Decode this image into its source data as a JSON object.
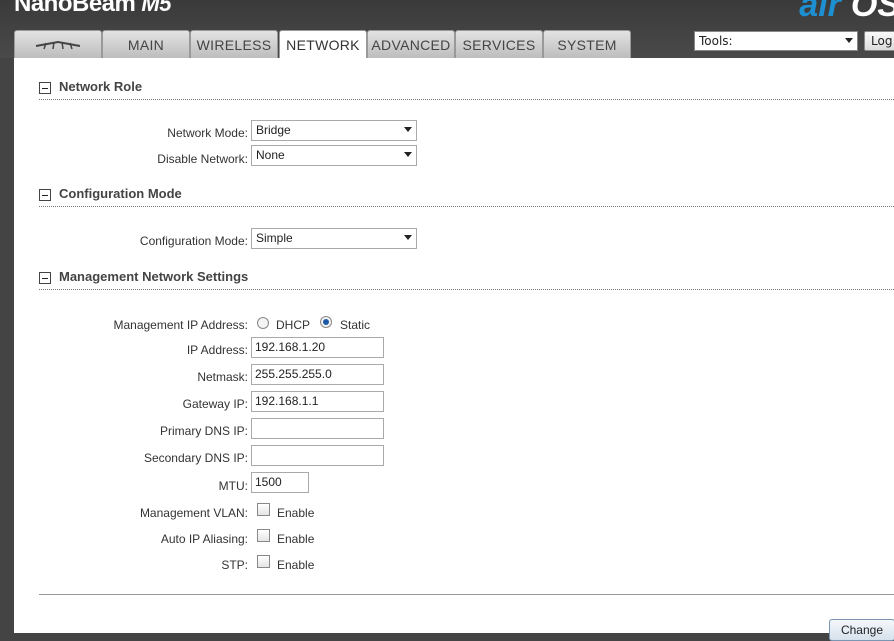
{
  "brand": {
    "name": "NanoBeam",
    "model_mark": "M5"
  },
  "logo": {
    "prefix": "air",
    "text": "OS"
  },
  "tabs": [
    {
      "label": "",
      "icon": "ubiquiti-logo-icon"
    },
    {
      "label": "MAIN"
    },
    {
      "label": "WIRELESS"
    },
    {
      "label": "NETWORK",
      "active": true
    },
    {
      "label": "ADVANCED"
    },
    {
      "label": "SERVICES"
    },
    {
      "label": "SYSTEM"
    }
  ],
  "tools": {
    "label": "Tools:"
  },
  "logout": {
    "label": "Log"
  },
  "sections": {
    "network_role": {
      "title": "Network Role",
      "network_mode": {
        "label": "Network Mode:",
        "value": "Bridge"
      },
      "disable_network": {
        "label": "Disable Network:",
        "value": "None"
      }
    },
    "config_mode": {
      "title": "Configuration Mode",
      "configuration_mode": {
        "label": "Configuration Mode:",
        "value": "Simple"
      }
    },
    "management": {
      "title": "Management Network Settings",
      "mgmt_ip": {
        "label": "Management IP Address:",
        "dhcp": "DHCP",
        "static": "Static",
        "selected": "Static"
      },
      "ip_address": {
        "label": "IP Address:",
        "value": "192.168.1.20"
      },
      "netmask": {
        "label": "Netmask:",
        "value": "255.255.255.0"
      },
      "gateway": {
        "label": "Gateway IP:",
        "value": "192.168.1.1"
      },
      "primary_dns": {
        "label": "Primary DNS IP:",
        "value": ""
      },
      "secondary_dns": {
        "label": "Secondary DNS IP:",
        "value": ""
      },
      "mtu": {
        "label": "MTU:",
        "value": "1500"
      },
      "mgmt_vlan": {
        "label": "Management VLAN:",
        "option": "Enable",
        "checked": false
      },
      "auto_ip_aliasing": {
        "label": "Auto IP Aliasing:",
        "option": "Enable",
        "checked": false
      },
      "stp": {
        "label": "STP:",
        "option": "Enable",
        "checked": false
      }
    }
  },
  "change_button": {
    "label": "Change"
  }
}
